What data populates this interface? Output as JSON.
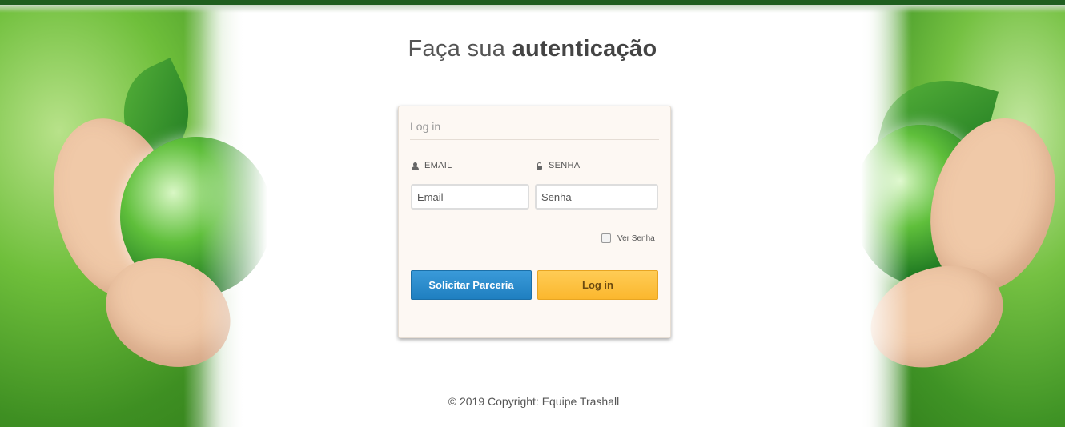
{
  "page": {
    "title_light": "Faça sua",
    "title_bold": "autenticação"
  },
  "login_card": {
    "heading": "Log in",
    "email_label": "EMAIL",
    "email_placeholder": "Email",
    "password_label": "SENHA",
    "password_placeholder": "Senha",
    "show_password_label": "Ver Senha",
    "show_password_checked": false,
    "request_partnership_button": "Solicitar Parceria",
    "login_button": "Log in"
  },
  "footer": {
    "copyright": "© 2019 Copyright: Equipe Trashall"
  },
  "colors": {
    "topbar": "#1f5e1f",
    "primary_button": "#2a8bcc",
    "warning_button": "#fbbd3a",
    "card_background": "#fdf8f3"
  },
  "icons": {
    "email": "user-icon",
    "password": "lock-icon"
  }
}
